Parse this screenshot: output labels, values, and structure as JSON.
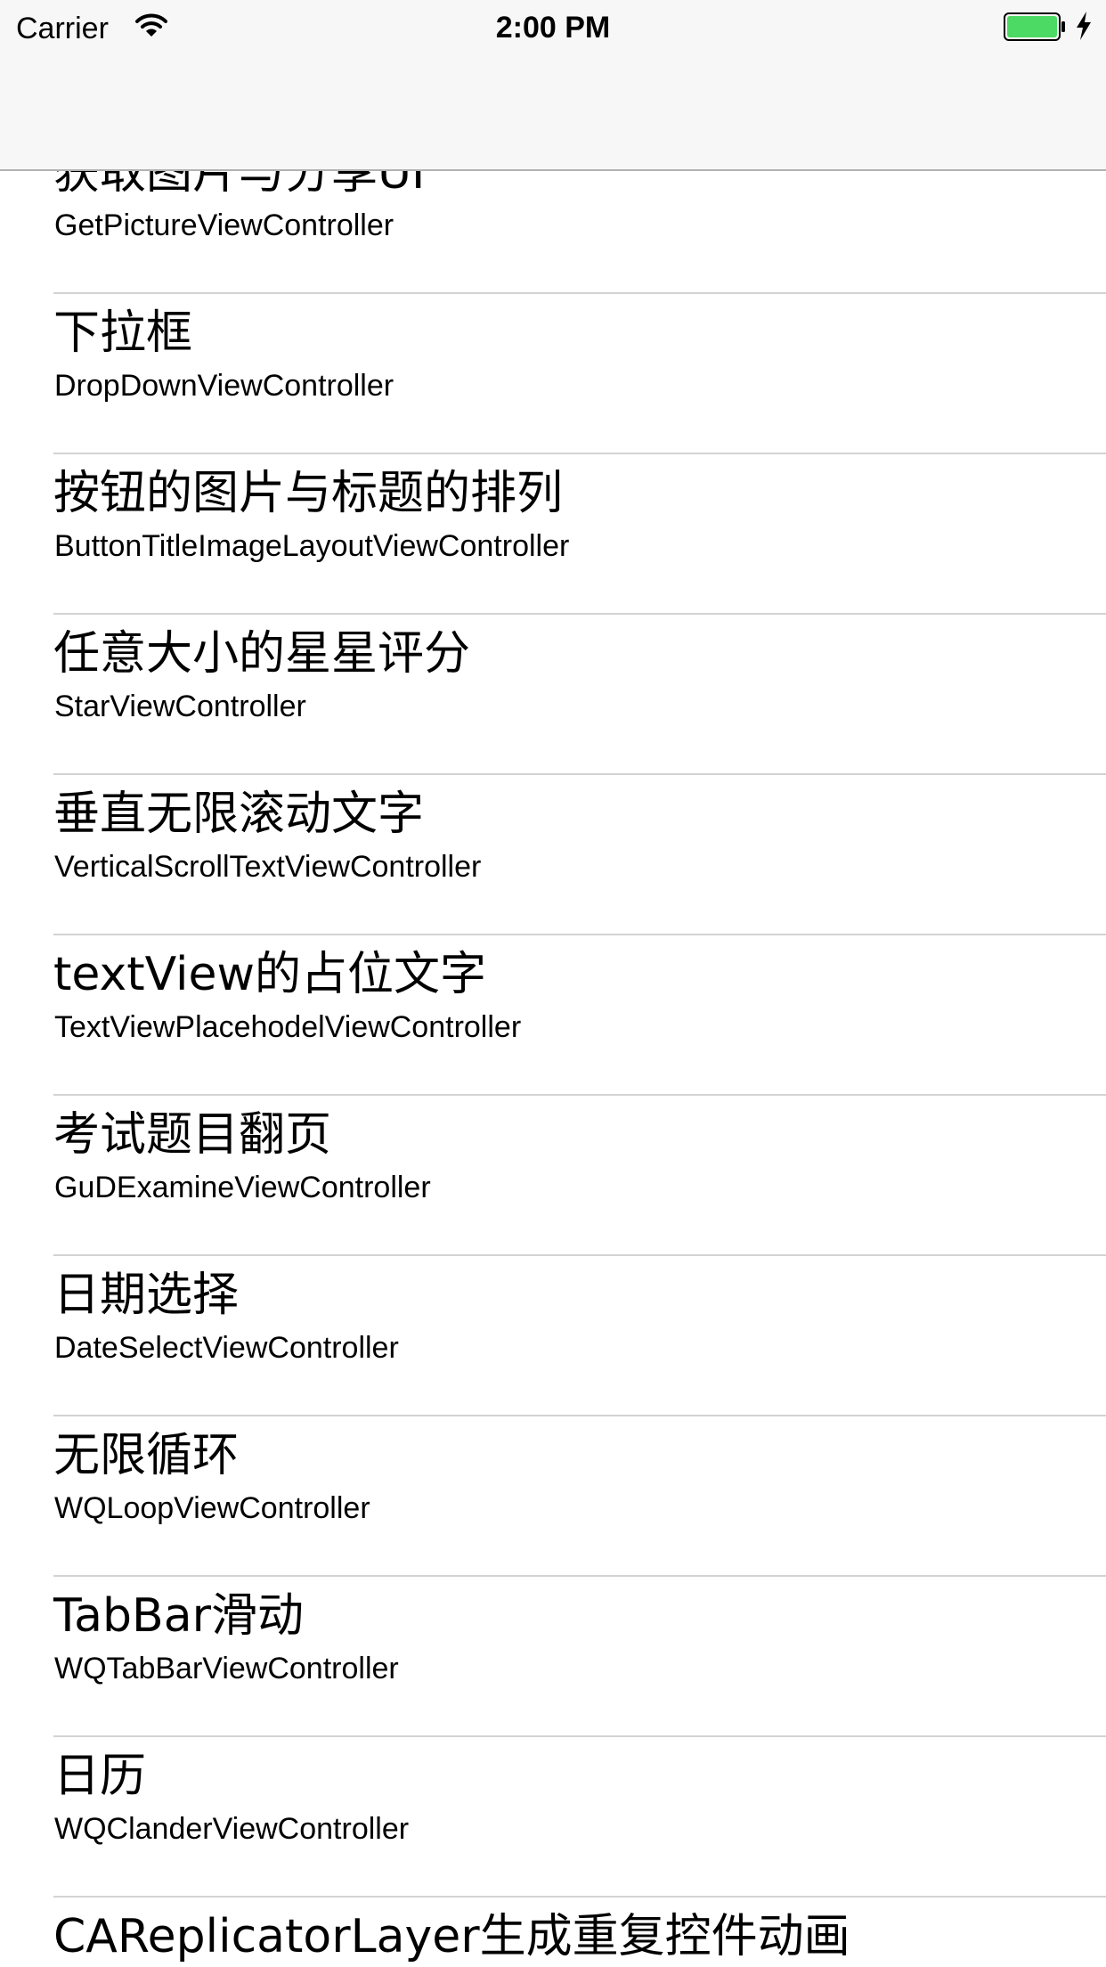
{
  "status_bar": {
    "carrier": "Carrier",
    "time": "2:00 PM",
    "battery_color": "#4cd964"
  },
  "table": {
    "rows": [
      {
        "title": "获取图片与分享UI",
        "subtitle": "GetPictureViewController"
      },
      {
        "title": "下拉框",
        "subtitle": "DropDownViewController"
      },
      {
        "title": "按钮的图片与标题的排列",
        "subtitle": "ButtonTitleImageLayoutViewController"
      },
      {
        "title": "任意大小的星星评分",
        "subtitle": "StarViewController"
      },
      {
        "title": "垂直无限滚动文字",
        "subtitle": "VerticalScrollTextViewController"
      },
      {
        "title": "textView的占位文字",
        "subtitle": "TextViewPlacehodelViewController"
      },
      {
        "title": "考试题目翻页",
        "subtitle": "GuDExamineViewController"
      },
      {
        "title": "日期选择",
        "subtitle": "DateSelectViewController"
      },
      {
        "title": "无限循环",
        "subtitle": "WQLoopViewController"
      },
      {
        "title": "TabBar滑动",
        "subtitle": "WQTabBarViewController"
      },
      {
        "title": "日历",
        "subtitle": "WQClanderViewController"
      },
      {
        "title": "CAReplicatorLayer生成重复控件动画",
        "subtitle": ""
      }
    ]
  }
}
